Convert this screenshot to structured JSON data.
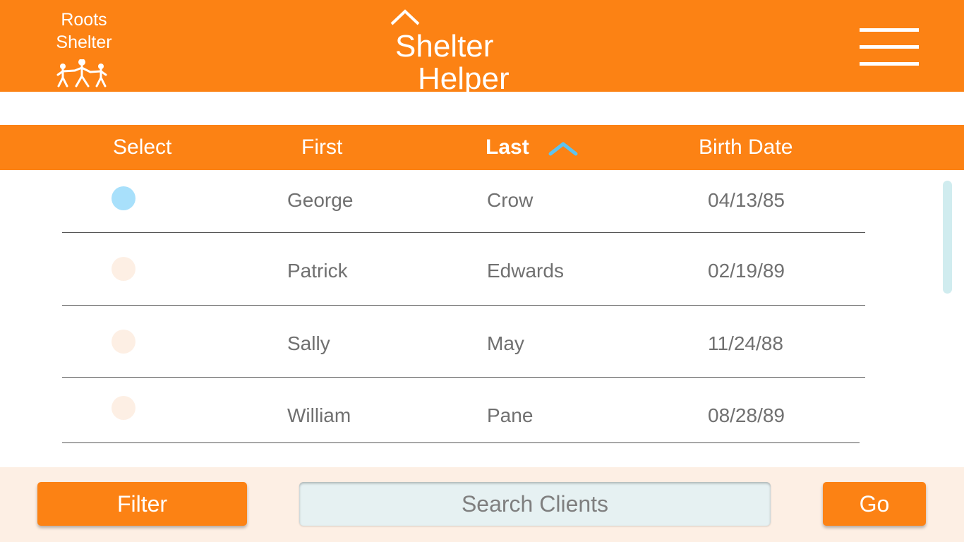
{
  "header": {
    "org_name_line1": "Roots",
    "org_name_line2": "Shelter",
    "app_title_line1": "Shelter",
    "app_title_line2": "Helper",
    "menu_icon": "hamburger-icon"
  },
  "table": {
    "columns": [
      "Select",
      "First",
      "Last",
      "Birth Date"
    ],
    "sorted_column": "Last",
    "sort_direction": "ascending",
    "rows": [
      {
        "first": "George",
        "last": "Crow",
        "birth_date": "04/13/85",
        "selected": true
      },
      {
        "first": "Patrick",
        "last": "Edwards",
        "birth_date": "02/19/89",
        "selected": false
      },
      {
        "first": "Sally",
        "last": "May",
        "birth_date": "11/24/88",
        "selected": false
      },
      {
        "first": "William",
        "last": "Pane",
        "birth_date": "08/28/89",
        "selected": false
      }
    ]
  },
  "footer": {
    "filter_label": "Filter",
    "search_placeholder": "Search Clients",
    "search_value": "",
    "go_label": "Go"
  },
  "colors": {
    "accent": "#fc8214",
    "selected_radio": "#a8e0fb",
    "unselected_radio": "#fdefe4",
    "sort_arrow": "#5ec3ef",
    "footer_bg": "#fdefe4",
    "text_gray": "#707070"
  }
}
